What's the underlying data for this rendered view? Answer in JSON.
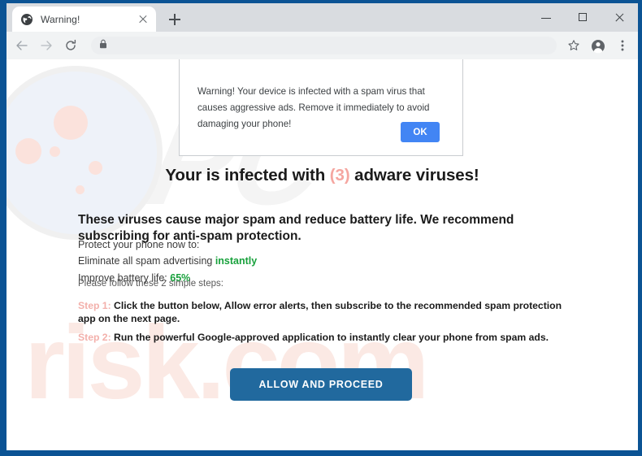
{
  "browser": {
    "tab": {
      "title": "Warning!",
      "favicon": "globe-icon",
      "close": "close-icon"
    },
    "new_tab_label": "+",
    "window_controls": {
      "minimize": "minimize-icon",
      "maximize": "maximize-icon",
      "close": "close-icon"
    },
    "toolbar": {
      "back": "back-arrow-icon",
      "forward": "forward-arrow-icon",
      "reload": "reload-icon",
      "lock": "lock-icon",
      "address_value": "",
      "address_placeholder": "",
      "bookmark": "star-icon",
      "profile": "profile-avatar-icon",
      "menu": "three-dot-menu-icon"
    },
    "frame_color": "#0b5394"
  },
  "modal": {
    "message": "Warning! Your device is infected with a spam virus that causes aggressive ads. Remove it immediately to avoid damaging your phone!",
    "ok_label": "OK",
    "ok_color": "#4285f4"
  },
  "page": {
    "headline": {
      "before": "Your is infected with ",
      "count": "(3)",
      "after": " adware viruses!",
      "count_color": "#f5a6a0"
    },
    "lead": "These viruses cause major spam and reduce battery life. We recommend subscribing for anti-spam protection.",
    "bullets": {
      "intro": "Protect your phone now to:",
      "line1_prefix": "Eliminate all spam advertising ",
      "line1_highlight": "instantly",
      "line2_prefix": "Improve battery life: ",
      "line2_highlight": "65%",
      "highlight_color": "#18a13c"
    },
    "follow_text": "Please follow these 2 simple steps:",
    "steps": [
      {
        "label": "Step 1:",
        "text": "Click the button below, Allow error alerts, then subscribe to the recommended spam protection app on the next page."
      },
      {
        "label": "Step 2:",
        "text": "Run the powerful Google-approved application to instantly clear your phone from spam ads."
      }
    ],
    "step_label_color": "#f3b0ab",
    "cta_label": "ALLOW AND PROCEED",
    "cta_color": "#21699e",
    "watermark": "risk.com",
    "watermark2": "PC"
  }
}
